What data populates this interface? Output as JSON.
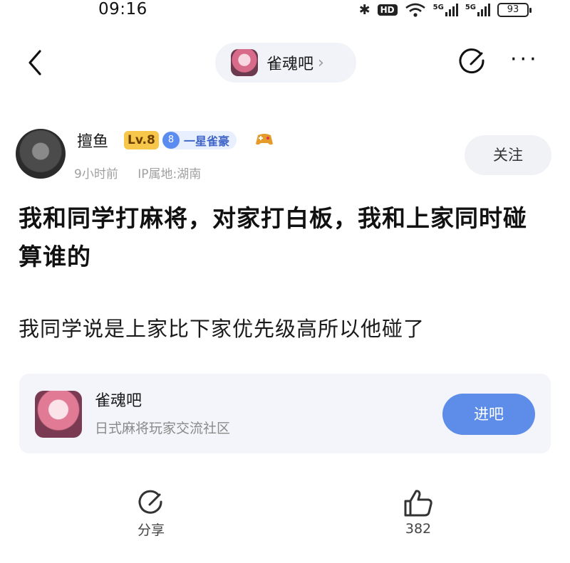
{
  "status_bar": {
    "time": "09:16",
    "hd_label": "HD",
    "network_labels": [
      "5G",
      "5G"
    ],
    "battery": "93"
  },
  "nav": {
    "forum_name": "雀魂吧",
    "chevron": "›"
  },
  "post": {
    "author": "擅鱼",
    "level": "Lv.8",
    "rank_number": "8",
    "rank_label": "一星雀豪",
    "time_ago": "9小时前",
    "ip_location": "IP属地:湖南",
    "follow_label": "关注",
    "title": "我和同学打麻将，对家打白板，我和上家同时碰算谁的",
    "body": "我同学说是上家比下家优先级高所以他碰了"
  },
  "forum_card": {
    "name": "雀魂吧",
    "description": "日式麻将玩家交流社区",
    "enter_label": "进吧"
  },
  "actions": {
    "share_label": "分享",
    "like_count": "382"
  },
  "icons": {
    "back": "chevron-left-icon",
    "edit": "edit-icon",
    "more": "more-dots-icon",
    "share": "share-icon",
    "like": "thumbs-up-icon"
  },
  "colors": {
    "accent": "#5d8de8",
    "level_badge": "#f6c74a",
    "rank_badge": "#5b8cf0"
  }
}
